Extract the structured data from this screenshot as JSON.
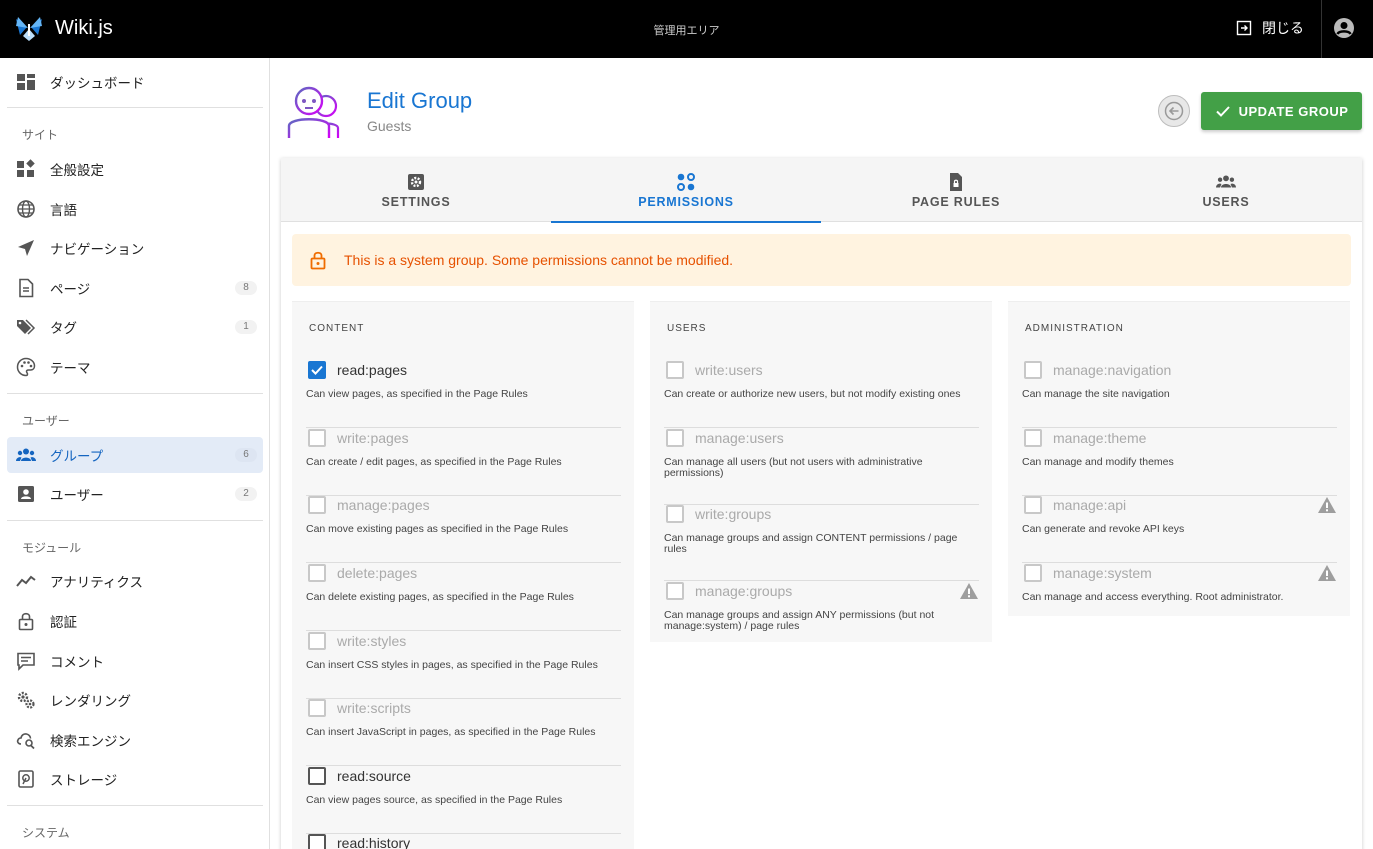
{
  "topbar": {
    "app_title": "Wiki.js",
    "center_label": "管理用エリア",
    "close_label": "閉じる"
  },
  "sidebar": {
    "dashboard": "ダッシュボード",
    "sections": {
      "site": "サイト",
      "users": "ユーザー",
      "modules": "モジュール",
      "system": "システム"
    },
    "items": [
      {
        "label": "全般設定",
        "icon": "dashboard-widgets-icon"
      },
      {
        "label": "言語",
        "icon": "globe-icon"
      },
      {
        "label": "ナビゲーション",
        "icon": "navigation-icon"
      },
      {
        "label": "ページ",
        "icon": "file-icon",
        "count": "8"
      },
      {
        "label": "タグ",
        "icon": "tags-icon",
        "count": "1"
      },
      {
        "label": "テーマ",
        "icon": "palette-icon"
      },
      {
        "label": "グループ",
        "icon": "group-icon",
        "count": "6",
        "active": true
      },
      {
        "label": "ユーザー",
        "icon": "user-card-icon",
        "count": "2"
      },
      {
        "label": "アナリティクス",
        "icon": "analytics-icon"
      },
      {
        "label": "認証",
        "icon": "lock-icon"
      },
      {
        "label": "コメント",
        "icon": "comment-icon"
      },
      {
        "label": "レンダリング",
        "icon": "cogs-icon"
      },
      {
        "label": "検索エンジン",
        "icon": "cloud-search-icon"
      },
      {
        "label": "ストレージ",
        "icon": "storage-icon"
      }
    ]
  },
  "header": {
    "title": "Edit Group",
    "subtitle": "Guests",
    "update_label": "UPDATE GROUP"
  },
  "tabs": [
    {
      "label": "SETTINGS",
      "icon": "settings-icon"
    },
    {
      "label": "PERMISSIONS",
      "icon": "permissions-icon",
      "active": true
    },
    {
      "label": "PAGE RULES",
      "icon": "page-rules-icon"
    },
    {
      "label": "USERS",
      "icon": "users-icon"
    }
  ],
  "alert": {
    "text": "This is a system group. Some permissions cannot be modified."
  },
  "columns": [
    {
      "heading": "CONTENT",
      "permissions": [
        {
          "name": "read:pages",
          "desc": "Can view pages, as specified in the Page Rules",
          "checked": true,
          "enabled": true
        },
        {
          "name": "write:pages",
          "desc": "Can create / edit pages, as specified in the Page Rules",
          "checked": false,
          "enabled": false
        },
        {
          "name": "manage:pages",
          "desc": "Can move existing pages as specified in the Page Rules",
          "checked": false,
          "enabled": false
        },
        {
          "name": "delete:pages",
          "desc": "Can delete existing pages, as specified in the Page Rules",
          "checked": false,
          "enabled": false
        },
        {
          "name": "write:styles",
          "desc": "Can insert CSS styles in pages, as specified in the Page Rules",
          "checked": false,
          "enabled": false
        },
        {
          "name": "write:scripts",
          "desc": "Can insert JavaScript in pages, as specified in the Page Rules",
          "checked": false,
          "enabled": false
        },
        {
          "name": "read:source",
          "desc": "Can view pages source, as specified in the Page Rules",
          "checked": false,
          "enabled": true
        },
        {
          "name": "read:history",
          "desc": "",
          "checked": false,
          "enabled": true
        }
      ]
    },
    {
      "heading": "USERS",
      "permissions": [
        {
          "name": "write:users",
          "desc": "Can create or authorize new users, but not modify existing ones",
          "checked": false,
          "enabled": false
        },
        {
          "name": "manage:users",
          "desc": "Can manage all users (but not users with administrative permissions)",
          "checked": false,
          "enabled": false
        },
        {
          "name": "write:groups",
          "desc": "Can manage groups and assign CONTENT permissions / page rules",
          "checked": false,
          "enabled": false
        },
        {
          "name": "manage:groups",
          "desc": "Can manage groups and assign ANY permissions (but not manage:system) / page rules",
          "checked": false,
          "enabled": false,
          "warning": true
        }
      ]
    },
    {
      "heading": "ADMINISTRATION",
      "permissions": [
        {
          "name": "manage:navigation",
          "desc": "Can manage the site navigation",
          "checked": false,
          "enabled": false
        },
        {
          "name": "manage:theme",
          "desc": "Can manage and modify themes",
          "checked": false,
          "enabled": false
        },
        {
          "name": "manage:api",
          "desc": "Can generate and revoke API keys",
          "checked": false,
          "enabled": false,
          "warning": true
        },
        {
          "name": "manage:system",
          "desc": "Can manage and access everything. Root administrator.",
          "checked": false,
          "enabled": false,
          "warning": true
        }
      ]
    }
  ],
  "colors": {
    "accent": "#1976d2",
    "update": "#43a047",
    "alert_bg": "#fff3e0",
    "alert_text": "#e65100"
  }
}
